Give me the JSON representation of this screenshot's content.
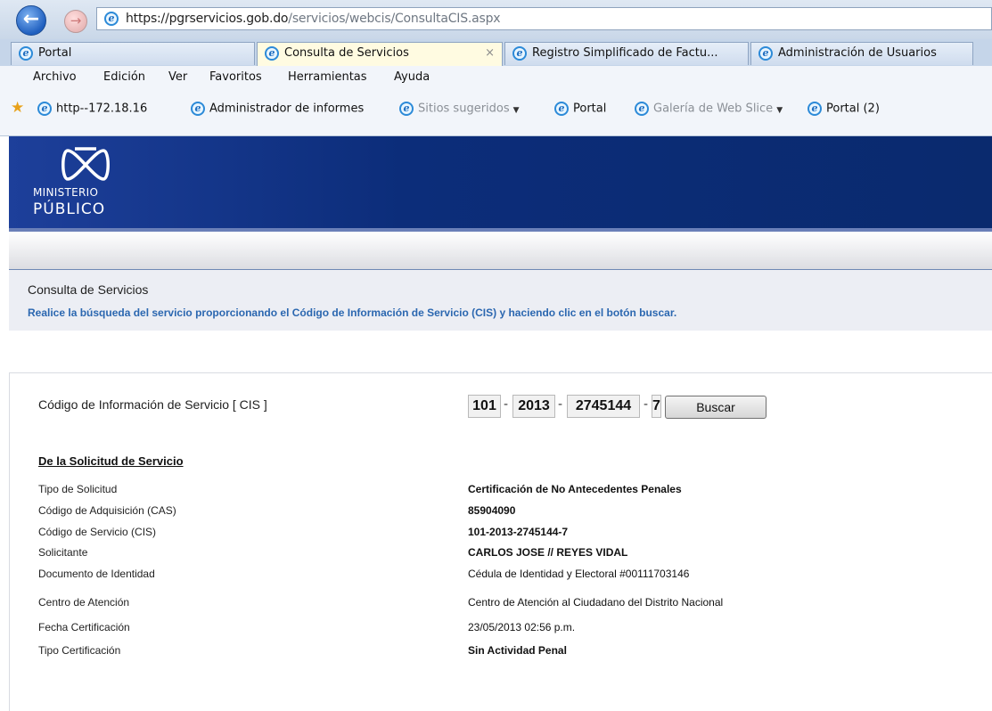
{
  "browser": {
    "url_host": "https://pgrservicios.gob.do",
    "url_path": "/servicios/webcis/ConsultaCIS.aspx",
    "tabs": [
      {
        "label": "Portal"
      },
      {
        "label": "Consulta de Servicios"
      },
      {
        "label": "Registro Simplificado de Factu..."
      },
      {
        "label": "Administración de Usuarios"
      }
    ],
    "tab_close": "×",
    "menu": [
      "Archivo",
      "Edición",
      "Ver",
      "Favoritos",
      "Herramientas",
      "Ayuda"
    ],
    "favorites": [
      {
        "label": "http--172.18.16"
      },
      {
        "label": "Administrador de informes"
      },
      {
        "label": "Sitios sugeridos"
      },
      {
        "label": "Portal"
      },
      {
        "label": "Galería de Web Slice"
      },
      {
        "label": "Portal (2)"
      }
    ]
  },
  "logo": {
    "line1": "MINISTERIO",
    "line2": "PÚBLICO"
  },
  "page": {
    "title": "Consulta de Servicios",
    "description": "Realice la búsqueda del servicio proporcionando el Código de Información de Servicio (CIS) y haciendo clic en el botón buscar."
  },
  "search": {
    "label": "Código de Información de Servicio [ CIS ]",
    "parts": [
      "101",
      "2013",
      "2745144",
      "7"
    ],
    "separator": "-",
    "button": "Buscar"
  },
  "details": {
    "section_title": "De la Solicitud de Servicio",
    "rows": [
      {
        "label": "Tipo de Solicitud",
        "value": "Certificación de No Antecedentes Penales"
      },
      {
        "label": "Código de Adquisición (CAS)",
        "value": "85904090"
      },
      {
        "label": "Código de Servicio (CIS)",
        "value": "101-2013-2745144-7"
      },
      {
        "label": "Solicitante",
        "value": "CARLOS JOSE // REYES VIDAL"
      },
      {
        "label": "Documento de Identidad",
        "value": "Cédula de Identidad y Electoral #00111703146"
      },
      {
        "label": "Centro de Atención",
        "value": "Centro de Atención al Ciudadano del Distrito Nacional"
      },
      {
        "label": "Fecha Certificación",
        "value": "23/05/2013 02:56 p.m."
      },
      {
        "label": "Tipo Certificación",
        "value": "Sin Actividad Penal"
      }
    ]
  }
}
